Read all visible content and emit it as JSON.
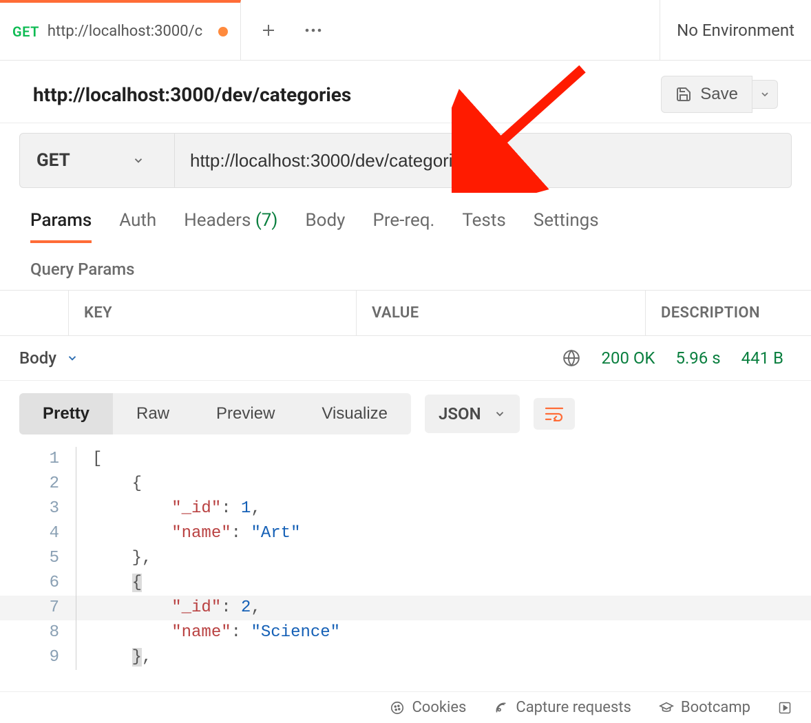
{
  "tab": {
    "method": "GET",
    "title": "http://localhost:3000/c",
    "dirty": true
  },
  "env": {
    "label": "No Environment"
  },
  "request": {
    "title": "http://localhost:3000/dev/categories",
    "save_label": "Save",
    "method": "GET",
    "url": "http://localhost:3000/dev/categories"
  },
  "req_tabs": {
    "params": "Params",
    "auth": "Auth",
    "headers": "Headers",
    "headers_count": "(7)",
    "body": "Body",
    "prereq": "Pre-req.",
    "tests": "Tests",
    "settings": "Settings"
  },
  "section_label": "Query Params",
  "kv_headers": {
    "key": "KEY",
    "value": "VALUE",
    "desc": "DESCRIPTION"
  },
  "response": {
    "body_label": "Body",
    "status": "200 OK",
    "time": "5.96 s",
    "size": "441 B",
    "views": {
      "pretty": "Pretty",
      "raw": "Raw",
      "preview": "Preview",
      "visualize": "Visualize"
    },
    "format": "JSON",
    "lines": [
      {
        "n": 1,
        "tokens": [
          {
            "c": "p",
            "t": "["
          }
        ]
      },
      {
        "n": 2,
        "tokens": [
          {
            "c": "p",
            "t": "    {"
          }
        ]
      },
      {
        "n": 3,
        "tokens": [
          {
            "c": "p",
            "t": "        "
          },
          {
            "c": "k",
            "t": "\"_id\""
          },
          {
            "c": "p",
            "t": ": "
          },
          {
            "c": "n",
            "t": "1"
          },
          {
            "c": "p",
            "t": ","
          }
        ]
      },
      {
        "n": 4,
        "tokens": [
          {
            "c": "p",
            "t": "        "
          },
          {
            "c": "k",
            "t": "\"name\""
          },
          {
            "c": "p",
            "t": ": "
          },
          {
            "c": "s",
            "t": "\"Art\""
          }
        ]
      },
      {
        "n": 5,
        "tokens": [
          {
            "c": "p",
            "t": "    },"
          }
        ]
      },
      {
        "n": 6,
        "tokens": [
          {
            "c": "p",
            "t": "    "
          },
          {
            "c": "p hl",
            "t": "{"
          }
        ],
        "braceHL": true
      },
      {
        "n": 7,
        "tokens": [
          {
            "c": "p",
            "t": "        "
          },
          {
            "c": "k",
            "t": "\"_id\""
          },
          {
            "c": "p",
            "t": ": "
          },
          {
            "c": "n",
            "t": "2"
          },
          {
            "c": "p",
            "t": ","
          }
        ],
        "rowHL": true
      },
      {
        "n": 8,
        "tokens": [
          {
            "c": "p",
            "t": "        "
          },
          {
            "c": "k",
            "t": "\"name\""
          },
          {
            "c": "p",
            "t": ": "
          },
          {
            "c": "s",
            "t": "\"Science\""
          }
        ]
      },
      {
        "n": 9,
        "tokens": [
          {
            "c": "p",
            "t": "    "
          },
          {
            "c": "p hl",
            "t": "}"
          },
          {
            "c": "p",
            "t": ","
          }
        ],
        "braceHL": true
      }
    ]
  },
  "footer": {
    "cookies": "Cookies",
    "capture": "Capture requests",
    "bootcamp": "Bootcamp"
  }
}
